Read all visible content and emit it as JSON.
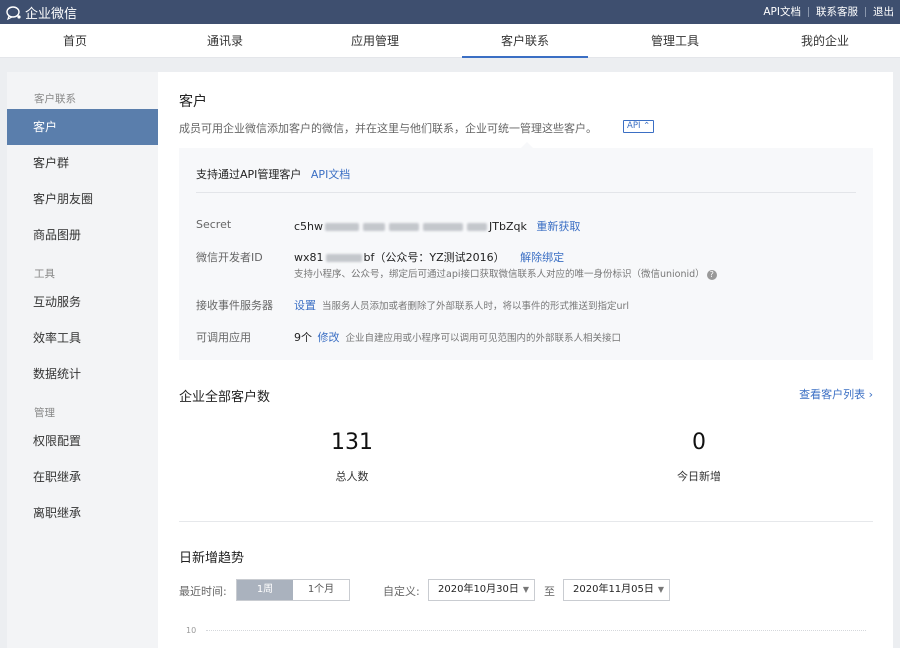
{
  "topbar": {
    "brand": "企业微信",
    "links": [
      "API文档",
      "联系客服",
      "退出"
    ]
  },
  "nav": {
    "items": [
      "首页",
      "通讯录",
      "应用管理",
      "客户联系",
      "管理工具",
      "我的企业"
    ],
    "active_index": 3
  },
  "sidebar": {
    "groups": [
      {
        "title": "客户联系",
        "items": [
          "客户",
          "客户群",
          "客户朋友圈",
          "商品图册"
        ]
      },
      {
        "title": "工具",
        "items": [
          "互动服务",
          "效率工具",
          "数据统计"
        ]
      },
      {
        "title": "管理",
        "items": [
          "权限配置",
          "在职继承",
          "离职继承"
        ]
      }
    ],
    "active_item": "客户"
  },
  "main": {
    "title": "客户",
    "description": "成员可用企业微信添加客户的微信，并在这里与他们联系，企业可统一管理这些客户。",
    "api_tag": "API",
    "api_panel": {
      "heading": "支持通过API管理客户",
      "heading_link": "API文档",
      "secret": {
        "label": "Secret",
        "value_prefix": "c5hw",
        "value_suffix": "JTbZqk",
        "action": "重新获取"
      },
      "developer_id": {
        "label": "微信开发者ID",
        "value_prefix": "wx81",
        "value_suffix": "bf（公众号：YZ测试2016）",
        "action": "解除绑定",
        "hint": "支持小程序、公众号，绑定后可通过api接口获取微信联系人对应的唯一身份标识（微信unionid）"
      },
      "event_server": {
        "label": "接收事件服务器",
        "action": "设置",
        "note": "当服务人员添加或者删除了外部联系人时，将以事件的形式推送到指定url"
      },
      "callable_apps": {
        "label": "可调用应用",
        "count": "9个",
        "action": "修改",
        "note": "企业自建应用或小程序可以调用可见范围内的外部联系人相关接口"
      }
    },
    "total_section": {
      "title": "企业全部客户数",
      "link": "查看客户列表 ›",
      "stats": [
        {
          "value": "131",
          "label": "总人数"
        },
        {
          "value": "0",
          "label": "今日新增"
        }
      ]
    },
    "trend_section": {
      "title": "日新增趋势",
      "time_label": "最近时间:",
      "range_options": [
        "1周",
        "1个月"
      ],
      "range_selected": "1周",
      "custom_label": "自定义:",
      "date_from": "2020年10月30日",
      "to_label": "至",
      "date_to": "2020年11月05日",
      "y_tick": "10"
    }
  }
}
